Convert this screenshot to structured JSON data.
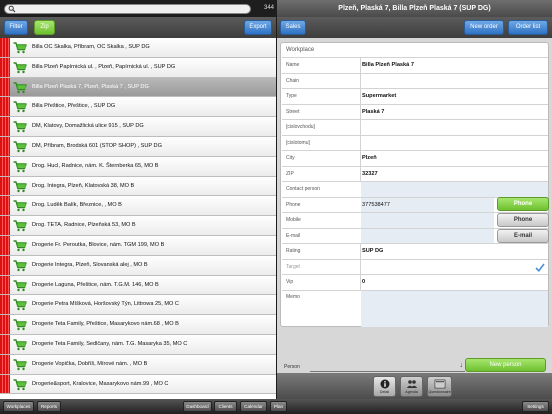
{
  "left": {
    "search_count": "344",
    "toolbar": {
      "filter": "Filter",
      "zip": "Zip",
      "export": "Export"
    },
    "stores": [
      "Billa OC Skalka, Příbram, OC Skalka , SUP DG",
      "Billa Plzeň Papírnická ul. , Plzeň, Papírnická ul. , SUP DG",
      "Billa Plzeň Plaská 7, Plzeň, Plaská 7 , SUP DG",
      "Billa Přeštice, Přeštice, , SUP DG",
      "DM, Klatovy, Domažlická ulice 915 , SUP DG",
      "DM, Příbram, Brodská 601 (STOP SHOP) , SUP DG",
      "Drog. Hucl, Radnice, nám. K. Šternberka 65, MO B",
      "Drog. Integra, Plzeň, Klatovská 38, MO B",
      "Drog. Luděk Balík, Březnice, , MO B",
      "Drog. TETA, Radnice, Plzeňská 53, MO B",
      "Drogerie Fr. Peroutka, Blovice, nám. TGM 199, MO B",
      "Drogerie Integra, Plzeň, Slovanská alej , MO B",
      "Drogerie Laguna, Přeštice, nám. T.G.M. 146, MO B",
      "Drogerie Petra Míšková, Horšovský Týn, Littrowa 25, MO C",
      "Drogerie Teta Family, Přeštice, Masarykovo nám.68 , MO B",
      "Drogerie Teta Family, Sedlčany, nám. T.G. Masaryka 35, MO C",
      "Drogerie Vopička, Dobříš, Mírové nám. , MO B",
      "Drogerie&sport, Kralovice, Masarykovo nám.99 , MO C"
    ],
    "selected_index": 2
  },
  "right": {
    "title": "Plzeň, Plaská 7, Billa Plzeň Plaská 7 (SUP DG)",
    "toolbar": {
      "sales": "Sales",
      "new_order": "New order",
      "order_list": "Order list"
    },
    "section_title": "Workplace",
    "fields": {
      "name_label": "Name",
      "name_value": "Billa Plzeň Plaská 7",
      "chain_label": "Chain",
      "chain_value": "",
      "type_label": "Type",
      "type_value": "Supermarket",
      "street_label": "Street",
      "street_value": "Plaská 7",
      "cislovychodu_label": "[cislovchodu]",
      "cislotomu_label": "[cislotomu]",
      "city_label": "City",
      "city_value": "Plzeň",
      "zip_label": "ZIP",
      "zip_value": "32327",
      "contact_label": "Contact person",
      "phone_label": "Phone",
      "phone_value": "377538477",
      "mobile_label": "Mobile",
      "email_label": "E-mail",
      "rating_label": "Rating",
      "rating_value": "SUP DG",
      "target_label": "Target",
      "vip_label": "Vip",
      "vip_value": "0",
      "memo_label": "Memo"
    },
    "side_buttons": {
      "phone_green": "Phone",
      "phone": "Phone",
      "email": "E-mail"
    },
    "person": {
      "label": "Person",
      "new_person": "New person"
    },
    "tabs": [
      {
        "label": "Detail",
        "icon": "info-icon"
      },
      {
        "label": "Agenda",
        "icon": "people-icon"
      },
      {
        "label": "Questionnaire",
        "icon": "form-icon"
      }
    ],
    "target_checked": true
  },
  "bottom": {
    "workplaces": "Workplaces",
    "reports": "Reports",
    "dashboard": "Dashboard",
    "clients": "Clients",
    "calendar": "Calendar",
    "plan": "Plan",
    "settings": "Settings"
  }
}
